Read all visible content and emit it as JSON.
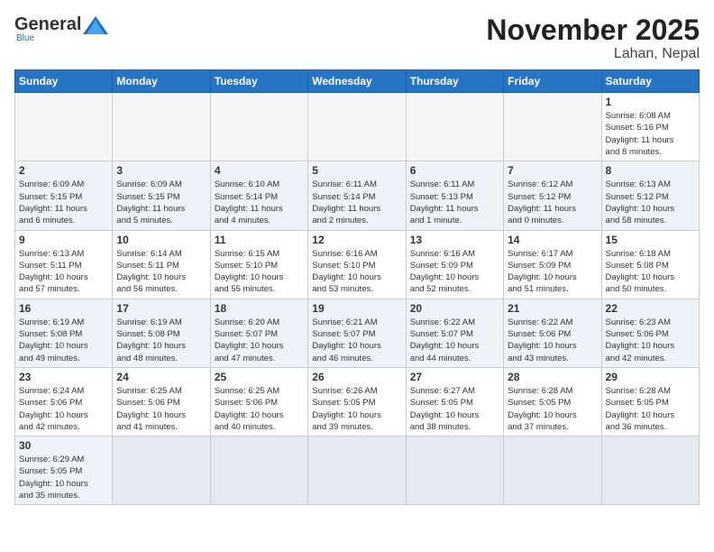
{
  "header": {
    "logo_general": "General",
    "logo_blue": "Blue",
    "month_title": "November 2025",
    "location": "Lahan, Nepal"
  },
  "weekdays": [
    "Sunday",
    "Monday",
    "Tuesday",
    "Wednesday",
    "Thursday",
    "Friday",
    "Saturday"
  ],
  "weeks": [
    [
      {
        "day": "",
        "info": "",
        "empty": true
      },
      {
        "day": "",
        "info": "",
        "empty": true
      },
      {
        "day": "",
        "info": "",
        "empty": true
      },
      {
        "day": "",
        "info": "",
        "empty": true
      },
      {
        "day": "",
        "info": "",
        "empty": true
      },
      {
        "day": "",
        "info": "",
        "empty": true
      },
      {
        "day": "1",
        "info": "Sunrise: 6:08 AM\nSunset: 5:16 PM\nDaylight: 11 hours\nand 8 minutes.",
        "empty": false
      }
    ],
    [
      {
        "day": "2",
        "info": "Sunrise: 6:09 AM\nSunset: 5:15 PM\nDaylight: 11 hours\nand 6 minutes.",
        "empty": false
      },
      {
        "day": "3",
        "info": "Sunrise: 6:09 AM\nSunset: 5:15 PM\nDaylight: 11 hours\nand 5 minutes.",
        "empty": false
      },
      {
        "day": "4",
        "info": "Sunrise: 6:10 AM\nSunset: 5:14 PM\nDaylight: 11 hours\nand 4 minutes.",
        "empty": false
      },
      {
        "day": "5",
        "info": "Sunrise: 6:11 AM\nSunset: 5:14 PM\nDaylight: 11 hours\nand 2 minutes.",
        "empty": false
      },
      {
        "day": "6",
        "info": "Sunrise: 6:11 AM\nSunset: 5:13 PM\nDaylight: 11 hours\nand 1 minute.",
        "empty": false
      },
      {
        "day": "7",
        "info": "Sunrise: 6:12 AM\nSunset: 5:12 PM\nDaylight: 11 hours\nand 0 minutes.",
        "empty": false
      },
      {
        "day": "8",
        "info": "Sunrise: 6:13 AM\nSunset: 5:12 PM\nDaylight: 10 hours\nand 58 minutes.",
        "empty": false
      }
    ],
    [
      {
        "day": "9",
        "info": "Sunrise: 6:13 AM\nSunset: 5:11 PM\nDaylight: 10 hours\nand 57 minutes.",
        "empty": false
      },
      {
        "day": "10",
        "info": "Sunrise: 6:14 AM\nSunset: 5:11 PM\nDaylight: 10 hours\nand 56 minutes.",
        "empty": false
      },
      {
        "day": "11",
        "info": "Sunrise: 6:15 AM\nSunset: 5:10 PM\nDaylight: 10 hours\nand 55 minutes.",
        "empty": false
      },
      {
        "day": "12",
        "info": "Sunrise: 6:16 AM\nSunset: 5:10 PM\nDaylight: 10 hours\nand 53 minutes.",
        "empty": false
      },
      {
        "day": "13",
        "info": "Sunrise: 6:16 AM\nSunset: 5:09 PM\nDaylight: 10 hours\nand 52 minutes.",
        "empty": false
      },
      {
        "day": "14",
        "info": "Sunrise: 6:17 AM\nSunset: 5:09 PM\nDaylight: 10 hours\nand 51 minutes.",
        "empty": false
      },
      {
        "day": "15",
        "info": "Sunrise: 6:18 AM\nSunset: 5:08 PM\nDaylight: 10 hours\nand 50 minutes.",
        "empty": false
      }
    ],
    [
      {
        "day": "16",
        "info": "Sunrise: 6:19 AM\nSunset: 5:08 PM\nDaylight: 10 hours\nand 49 minutes.",
        "empty": false
      },
      {
        "day": "17",
        "info": "Sunrise: 6:19 AM\nSunset: 5:08 PM\nDaylight: 10 hours\nand 48 minutes.",
        "empty": false
      },
      {
        "day": "18",
        "info": "Sunrise: 6:20 AM\nSunset: 5:07 PM\nDaylight: 10 hours\nand 47 minutes.",
        "empty": false
      },
      {
        "day": "19",
        "info": "Sunrise: 6:21 AM\nSunset: 5:07 PM\nDaylight: 10 hours\nand 46 minutes.",
        "empty": false
      },
      {
        "day": "20",
        "info": "Sunrise: 6:22 AM\nSunset: 5:07 PM\nDaylight: 10 hours\nand 44 minutes.",
        "empty": false
      },
      {
        "day": "21",
        "info": "Sunrise: 6:22 AM\nSunset: 5:06 PM\nDaylight: 10 hours\nand 43 minutes.",
        "empty": false
      },
      {
        "day": "22",
        "info": "Sunrise: 6:23 AM\nSunset: 5:06 PM\nDaylight: 10 hours\nand 42 minutes.",
        "empty": false
      }
    ],
    [
      {
        "day": "23",
        "info": "Sunrise: 6:24 AM\nSunset: 5:06 PM\nDaylight: 10 hours\nand 42 minutes.",
        "empty": false
      },
      {
        "day": "24",
        "info": "Sunrise: 6:25 AM\nSunset: 5:06 PM\nDaylight: 10 hours\nand 41 minutes.",
        "empty": false
      },
      {
        "day": "25",
        "info": "Sunrise: 6:25 AM\nSunset: 5:06 PM\nDaylight: 10 hours\nand 40 minutes.",
        "empty": false
      },
      {
        "day": "26",
        "info": "Sunrise: 6:26 AM\nSunset: 5:05 PM\nDaylight: 10 hours\nand 39 minutes.",
        "empty": false
      },
      {
        "day": "27",
        "info": "Sunrise: 6:27 AM\nSunset: 5:05 PM\nDaylight: 10 hours\nand 38 minutes.",
        "empty": false
      },
      {
        "day": "28",
        "info": "Sunrise: 6:28 AM\nSunset: 5:05 PM\nDaylight: 10 hours\nand 37 minutes.",
        "empty": false
      },
      {
        "day": "29",
        "info": "Sunrise: 6:28 AM\nSunset: 5:05 PM\nDaylight: 10 hours\nand 36 minutes.",
        "empty": false
      }
    ],
    [
      {
        "day": "30",
        "info": "Sunrise: 6:29 AM\nSunset: 5:05 PM\nDaylight: 10 hours\nand 35 minutes.",
        "empty": false
      },
      {
        "day": "",
        "info": "",
        "empty": true
      },
      {
        "day": "",
        "info": "",
        "empty": true
      },
      {
        "day": "",
        "info": "",
        "empty": true
      },
      {
        "day": "",
        "info": "",
        "empty": true
      },
      {
        "day": "",
        "info": "",
        "empty": true
      },
      {
        "day": "",
        "info": "",
        "empty": true
      }
    ]
  ]
}
